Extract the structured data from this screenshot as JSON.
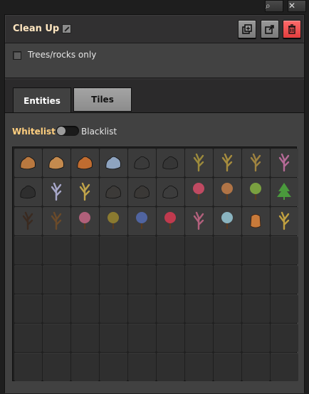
{
  "window": {
    "title": "Clean Up",
    "top_buttons": [
      "search-icon",
      "close-icon"
    ]
  },
  "header_buttons": [
    {
      "name": "copy-plan-button",
      "icon": "copy-icon"
    },
    {
      "name": "export-plan-button",
      "icon": "export-icon"
    },
    {
      "name": "delete-plan-button",
      "icon": "trash-icon",
      "color": "#e23d3d"
    }
  ],
  "options": {
    "trees_rocks_only": "Trees/rocks only",
    "checked": false
  },
  "tabs": [
    {
      "label": "Entities",
      "active": true
    },
    {
      "label": "Tiles",
      "active": false
    }
  ],
  "filter_mode": {
    "left": "Whitelist",
    "right": "Blacklist",
    "selected": "Whitelist"
  },
  "filter_slots": [
    {
      "icon": "rock-orange-icon",
      "color": "#b9783f"
    },
    {
      "icon": "rock-orange-small-icon",
      "color": "#c48a4e"
    },
    {
      "icon": "rock-orange-green-icon",
      "color": "#c06c30"
    },
    {
      "icon": "rock-blue-icon",
      "color": "#8ea4c0"
    },
    {
      "icon": "rock-dark-icon",
      "color": "#3a3a3a"
    },
    {
      "icon": "rock-dark-icon",
      "color": "#363636"
    },
    {
      "icon": "dead-tree-yellow-icon",
      "color": "#9c8a3c"
    },
    {
      "icon": "dead-tree-yellow-icon",
      "color": "#a68c3e"
    },
    {
      "icon": "dead-tree-yellow-icon",
      "color": "#9e8240"
    },
    {
      "icon": "coral-pink-icon",
      "color": "#b56a96"
    },
    {
      "icon": "rock-shadow-icon",
      "color": "#2e2e2e"
    },
    {
      "icon": "dead-tree-white-icon",
      "color": "#a6a6c8"
    },
    {
      "icon": "dead-tree-tan-icon",
      "color": "#c0a44a"
    },
    {
      "icon": "rock-dark-icon",
      "color": "#3c3a38"
    },
    {
      "icon": "rock-dark-icon",
      "color": "#3a3836"
    },
    {
      "icon": "rock-dark-icon",
      "color": "#3c3c3c"
    },
    {
      "icon": "tree-colorful-icon",
      "color": "#c04a62"
    },
    {
      "icon": "tree-colorful-icon",
      "color": "#b07446"
    },
    {
      "icon": "tree-colorful-icon",
      "color": "#7aa040"
    },
    {
      "icon": "pine-tree-green-icon",
      "color": "#4a9a3c"
    },
    {
      "icon": "dead-tree-dark-icon",
      "color": "#3a2a20"
    },
    {
      "icon": "dead-tree-brown-icon",
      "color": "#6a4a2a"
    },
    {
      "icon": "tree-pink-green-icon",
      "color": "#b0607a"
    },
    {
      "icon": "tree-olive-icon",
      "color": "#8a7a30"
    },
    {
      "icon": "tree-blue-yellow-icon",
      "color": "#5064a0"
    },
    {
      "icon": "tree-red-icon",
      "color": "#c03a4e"
    },
    {
      "icon": "coral-pink-tall-icon",
      "color": "#b2607c"
    },
    {
      "icon": "tree-pale-blue-icon",
      "color": "#8ab4c0"
    },
    {
      "icon": "stump-orange-icon",
      "color": "#c87a3a"
    },
    {
      "icon": "dead-tree-yellow-tall-icon",
      "color": "#c0a040"
    }
  ],
  "total_slots": 80
}
